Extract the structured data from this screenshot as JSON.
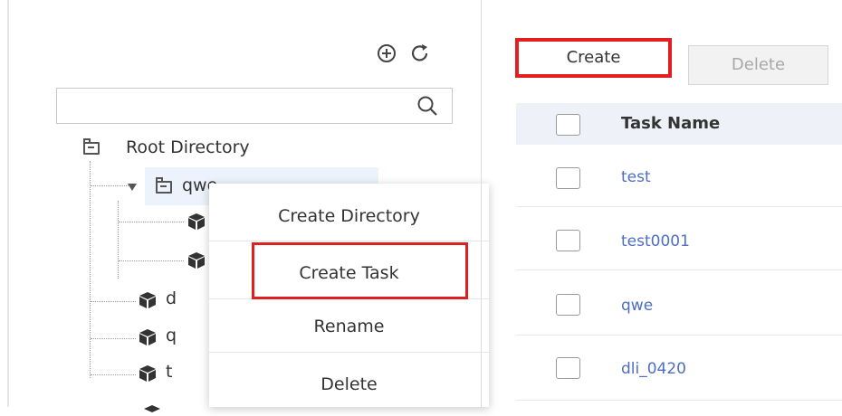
{
  "tree": {
    "root_label": "Root Directory",
    "selected_node_label": "qwe",
    "node_partial_labels": [
      "d",
      "q",
      "t"
    ],
    "search_placeholder": "",
    "icons": {
      "add": "plus-circle-icon",
      "refresh": "refresh-icon",
      "search": "search-icon"
    }
  },
  "context_menu": {
    "items": [
      "Create Directory",
      "Create Task",
      "Rename",
      "Delete"
    ],
    "highlighted": "Create Task"
  },
  "toolbar": {
    "create_label": "Create",
    "delete_label": "Delete"
  },
  "table": {
    "header": "Task Name",
    "rows": [
      "test",
      "test0001",
      "qwe",
      "dli_0420"
    ]
  },
  "colors": {
    "highlight_red": "#e02020",
    "link_blue": "#4e6ec3",
    "header_bg": "#eef2f8",
    "selected_bg": "#edf3fc"
  }
}
